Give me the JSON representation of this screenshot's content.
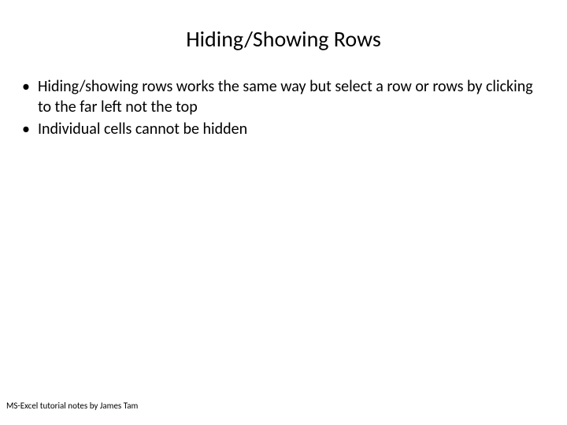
{
  "slide": {
    "title": "Hiding/Showing Rows",
    "bullets": [
      "Hiding/showing rows works the same way but select a row or rows by clicking to the far left not the top",
      "Individual cells cannot be hidden"
    ],
    "footer": "MS-Excel tutorial notes by James Tam"
  }
}
